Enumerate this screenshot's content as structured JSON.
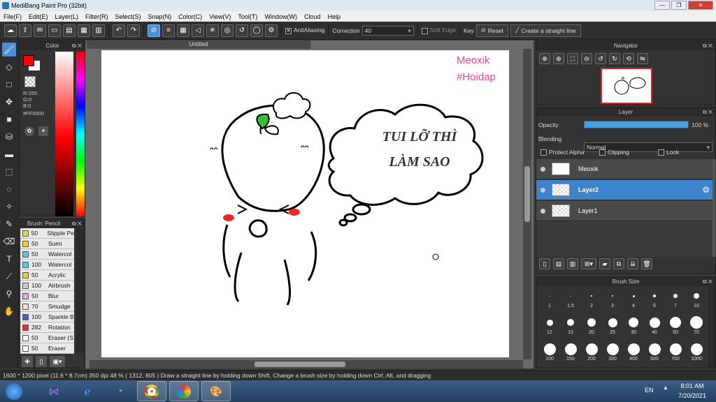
{
  "window": {
    "title": "MediBang Paint Pro (32bit)",
    "min": "—",
    "max": "❐",
    "close": "✕"
  },
  "menu": [
    "File(F)",
    "Edit(E)",
    "Layer(L)",
    "Filter(R)",
    "Select(S)",
    "Snap(N)",
    "Color(C)",
    "View(V)",
    "Tool(T)",
    "Window(W)",
    "Cloud",
    "Help"
  ],
  "toolbar": {
    "antialiasing_label": "AntiAliasing",
    "correction_label": "Correction",
    "correction_value": "40",
    "soft_edge_label": "Soft Edge",
    "key_label": "Key",
    "reset_label": "Reset",
    "straight_line_label": "Create a straight line"
  },
  "color_panel": {
    "title": "Color",
    "r": "R:255",
    "g": "G:0",
    "b": "B:0",
    "hex": "#FF0000",
    "fg": "#ff0000",
    "bg": "#ffffff"
  },
  "document": {
    "tab_title": "Untitled",
    "watermark1": "Meoxik",
    "watermark2": "#Hoidap",
    "bubble_line1": "TUI LỠ THÌ",
    "bubble_line2": "LÀM SAO"
  },
  "navigator": {
    "title": "Navigator"
  },
  "layer_panel": {
    "title": "Layer",
    "opacity_label": "Opacity",
    "opacity_value": "100 %",
    "opacity_fraction": 1.0,
    "blending_label": "Blending",
    "blending_value": "Normal",
    "protect_alpha_label": "Protect Alpha",
    "clipping_label": "Clipping",
    "lock_label": "Lock",
    "layers": [
      {
        "name": "Meoxik",
        "selected": false
      },
      {
        "name": "Layer2",
        "selected": true
      },
      {
        "name": "Layer1",
        "selected": false
      }
    ]
  },
  "brush_panel": {
    "title": "Brush: Pencil",
    "items": [
      {
        "size": "50",
        "name": "Stipple Pe",
        "color": "#e8d820"
      },
      {
        "size": "50",
        "name": "Sumi",
        "color": "#e8d820"
      },
      {
        "size": "50",
        "name": "Watercol",
        "color": "#58c8e8"
      },
      {
        "size": "100",
        "name": "Watercol",
        "color": "#58c8e8"
      },
      {
        "size": "50",
        "name": "Acrylic",
        "color": "#e8d820"
      },
      {
        "size": "100",
        "name": "Airbrush",
        "color": "#cccccc"
      },
      {
        "size": "50",
        "name": "Blur",
        "color": "#f0a0e0"
      },
      {
        "size": "70",
        "name": "Smudge",
        "color": "#f8d8c0"
      },
      {
        "size": "100",
        "name": "Sparkle B",
        "color": "#4060e0"
      },
      {
        "size": "282",
        "name": "Rotation",
        "color": "#e03030"
      },
      {
        "size": "50",
        "name": "Eraser (S",
        "color": "#ffffff"
      },
      {
        "size": "50",
        "name": "Eraser",
        "color": "#ffffff"
      }
    ]
  },
  "brush_size": {
    "title": "Brush Size",
    "sizes": [
      "1",
      "1.5",
      "2",
      "3",
      "4",
      "5",
      "7",
      "10",
      "12",
      "15",
      "20",
      "25",
      "30",
      "40",
      "50",
      "70",
      "100",
      "150",
      "200",
      "300",
      "400",
      "500",
      "700",
      "1000"
    ]
  },
  "status": {
    "text": "1600 * 1200 pixel   (11.6 * 8.7cm)   350 dpi   48 %   ( 1312, 805 )   Draw a straight line by holding down Shift, Change a brush size by holding down Ctrl, Alt, and dragging"
  },
  "taskbar": {
    "lang": "EN",
    "time": "8:01 AM",
    "date": "7/20/2021"
  }
}
